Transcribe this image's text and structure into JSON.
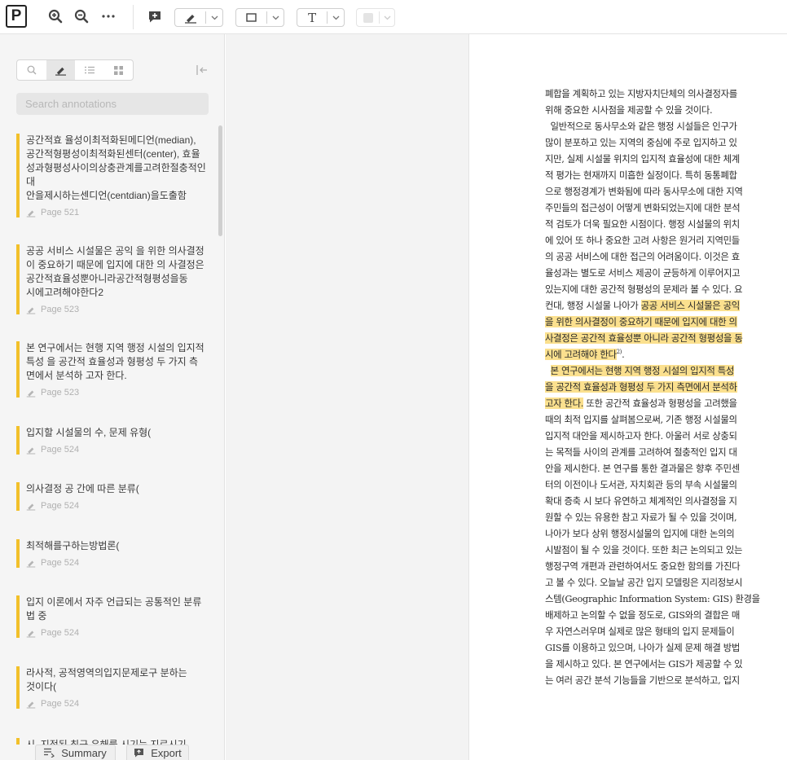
{
  "toolbar": {
    "logo_letter": "P",
    "zoom_in_icon": "zoom-in-icon",
    "zoom_out_icon": "zoom-out-icon",
    "more_icon": "more-horizontal-icon",
    "comment_icon": "add-comment-icon",
    "highlight_icon": "highlighter-pen-icon",
    "shape_icon": "rectangle-icon",
    "text_tool_letter": "T",
    "color_swatch": "#e4e4e4"
  },
  "sidebar": {
    "tabs": [
      {
        "name": "search-icon",
        "active": false
      },
      {
        "name": "highlighter-icon",
        "active": true
      },
      {
        "name": "list-icon",
        "active": false
      },
      {
        "name": "grid-icon",
        "active": false
      }
    ],
    "search_placeholder": "Search annotations",
    "accent": "#f2c02a",
    "annotations": [
      {
        "text": "공간적효 율성이최적화된메디언(median),\n공간적형평성이최적화된센터(center), 효율\n성과형평성사이의상충관계를고려한절충적인\n대\n안을제시하는센디언(centdian)을도출함",
        "page": "Page 521"
      },
      {
        "text": "공공 서비스 시설물은 공익 을 위한 의사결정\n이 중요하기 때문에 입지에 대한 의 사결정은\n공간적효율성뿐아니라공간적형평성을동\n시에고려해야한다2",
        "page": "Page 523"
      },
      {
        "text": "본 연구에서는 현행 지역 행정 시설의 입지적\n특성 을 공간적 효율성과 형평성 두 가지 측\n면에서 분석하 고자 한다.",
        "page": "Page 523"
      },
      {
        "text": "입지할 시설물의 수, 문제 유형(",
        "page": "Page 524"
      },
      {
        "text": "의사결정 공 간에 따른 분류(",
        "page": "Page 524"
      },
      {
        "text": "최적해를구하는방법론(",
        "page": "Page 524"
      },
      {
        "text": "입지 이론에서 자주 언급되는 공통적인 분류\n법 중",
        "page": "Page 524"
      },
      {
        "text": "라사적, 공적영역의입지문제로구 분하는\n것이다(",
        "page": "Page 524"
      },
      {
        "text": "시. 지정된 최근 유해를 시기는 지르시기",
        "page": ""
      }
    ],
    "summary_label": "Summary",
    "export_label": "Export"
  },
  "document": {
    "highlight_color": "#fbe08e",
    "lines": [
      {
        "segs": [
          {
            "t": "폐합을 계획하고 있는 지방자치단체의 의사결정자를"
          }
        ]
      },
      {
        "segs": [
          {
            "t": "위해 중요한 시사점을 제공할 수 있을 것이다."
          }
        ]
      },
      {
        "segs": [
          {
            "t": "  일반적으로 동사무소와 같은 행정 시설들은 인구가"
          }
        ]
      },
      {
        "segs": [
          {
            "t": "많이 분포하고 있는 지역의 중심에 주로 입지하고 있"
          }
        ]
      },
      {
        "segs": [
          {
            "t": "지만, 실제 시설물 위치의 입지적 효율성에 대한 체계"
          }
        ]
      },
      {
        "segs": [
          {
            "t": "적 평가는 현재까지 미흡한 실정이다. 특히 동통폐합"
          }
        ]
      },
      {
        "segs": [
          {
            "t": "으로 행정경계가 변화됨에 따라 동사무소에 대한 지역"
          }
        ]
      },
      {
        "segs": [
          {
            "t": "주민들의 접근성이 어떻게 변화되었는지에 대한 분석"
          }
        ]
      },
      {
        "segs": [
          {
            "t": "적 검토가 더욱 필요한 시점이다. 행정 시설물의 위치"
          }
        ]
      },
      {
        "segs": [
          {
            "t": "에 있어 또 하나 중요한 고려 사항은 원거리 지역민들"
          }
        ]
      },
      {
        "segs": [
          {
            "t": "의 공공 서비스에 대한 접근의 어려움이다. 이것은 효"
          }
        ]
      },
      {
        "segs": [
          {
            "t": "율성과는 별도로 서비스 제공이 균등하게 이루어지고"
          }
        ]
      },
      {
        "segs": [
          {
            "t": "있는지에 대한 공간적 형평성의 문제라 볼 수 있다. 요"
          }
        ]
      },
      {
        "segs": [
          {
            "t": "컨대, 행정 시설물 나아가 "
          },
          {
            "t": "공공 서비스 시설물은 공익",
            "hl": true
          }
        ]
      },
      {
        "segs": [
          {
            "t": "을 위한 의사결정이 중요하기 때문에 입지에 대한 의",
            "hl": true
          }
        ]
      },
      {
        "segs": [
          {
            "t": "사결정은 공간적 효율성뿐 아니라 공간적 형평성을 동",
            "hl": true
          }
        ]
      },
      {
        "segs": [
          {
            "t": "시에 고려해야 한다",
            "hl": true
          },
          {
            "t": "2)",
            "sup": true
          },
          {
            "t": "."
          }
        ]
      },
      {
        "segs": [
          {
            "t": "  "
          },
          {
            "t": "본 연구에서는 현행 지역 행정 시설의 입지적 특성",
            "hl": true
          }
        ]
      },
      {
        "segs": [
          {
            "t": "을 공간적 효율성과 형평성 두 가지 측면에서 분석하",
            "hl": true
          }
        ]
      },
      {
        "segs": [
          {
            "t": "고자 한다.",
            "hl": true
          },
          {
            "t": " 또한 공간적 효율성과 형평성을 고려했을"
          }
        ]
      },
      {
        "segs": [
          {
            "t": "때의 최적 입지를 살펴봄으로써, 기존 행정 시설물의"
          }
        ]
      },
      {
        "segs": [
          {
            "t": "입지적 대안을 제시하고자 한다. 아울러 서로 상충되"
          }
        ]
      },
      {
        "segs": [
          {
            "t": "는 목적들 사이의 관계를 고려하여 절충적인 입지 대"
          }
        ]
      },
      {
        "segs": [
          {
            "t": "안을 제시한다. 본 연구를 통한 결과물은 향후 주민센"
          }
        ]
      },
      {
        "segs": [
          {
            "t": "터의 이전이나 도서관, 자치회관 등의 부속 시설물의"
          }
        ]
      },
      {
        "segs": [
          {
            "t": "확대 증축 시 보다 유연하고 체계적인 의사결정을 지"
          }
        ]
      },
      {
        "segs": [
          {
            "t": "원할 수 있는 유용한 참고 자료가 될 수 있을 것이며,"
          }
        ]
      },
      {
        "segs": [
          {
            "t": "나아가 보다 상위 행정시설물의 입지에 대한 논의의"
          }
        ]
      },
      {
        "segs": [
          {
            "t": "시발점이 될 수 있을 것이다. 또한 최근 논의되고 있는"
          }
        ]
      },
      {
        "segs": [
          {
            "t": "행정구역 개편과 관련하여서도 중요한 함의를 가진다"
          }
        ]
      },
      {
        "segs": [
          {
            "t": "고 볼 수 있다. 오늘날 공간 입지 모델링은 지리정보시"
          }
        ]
      },
      {
        "segs": [
          {
            "t": "스템(Geographic Information System: GIS) 환경을"
          }
        ]
      },
      {
        "segs": [
          {
            "t": "배제하고 논의할 수 없을 정도로, GIS와의 결합은 매"
          }
        ]
      },
      {
        "segs": [
          {
            "t": "우 자연스러우며 실제로 많은 형태의 입지 문제들이"
          }
        ]
      },
      {
        "segs": [
          {
            "t": "GIS를 이용하고 있으며, 나아가 실제 문제 해결 방법"
          }
        ]
      },
      {
        "segs": [
          {
            "t": "을 제시하고 있다. 본 연구에서는 GIS가 제공할 수 있"
          }
        ]
      },
      {
        "segs": [
          {
            "t": "는 여러 공간 분석 기능들을 기반으로 분석하고, 입지"
          }
        ]
      }
    ]
  }
}
